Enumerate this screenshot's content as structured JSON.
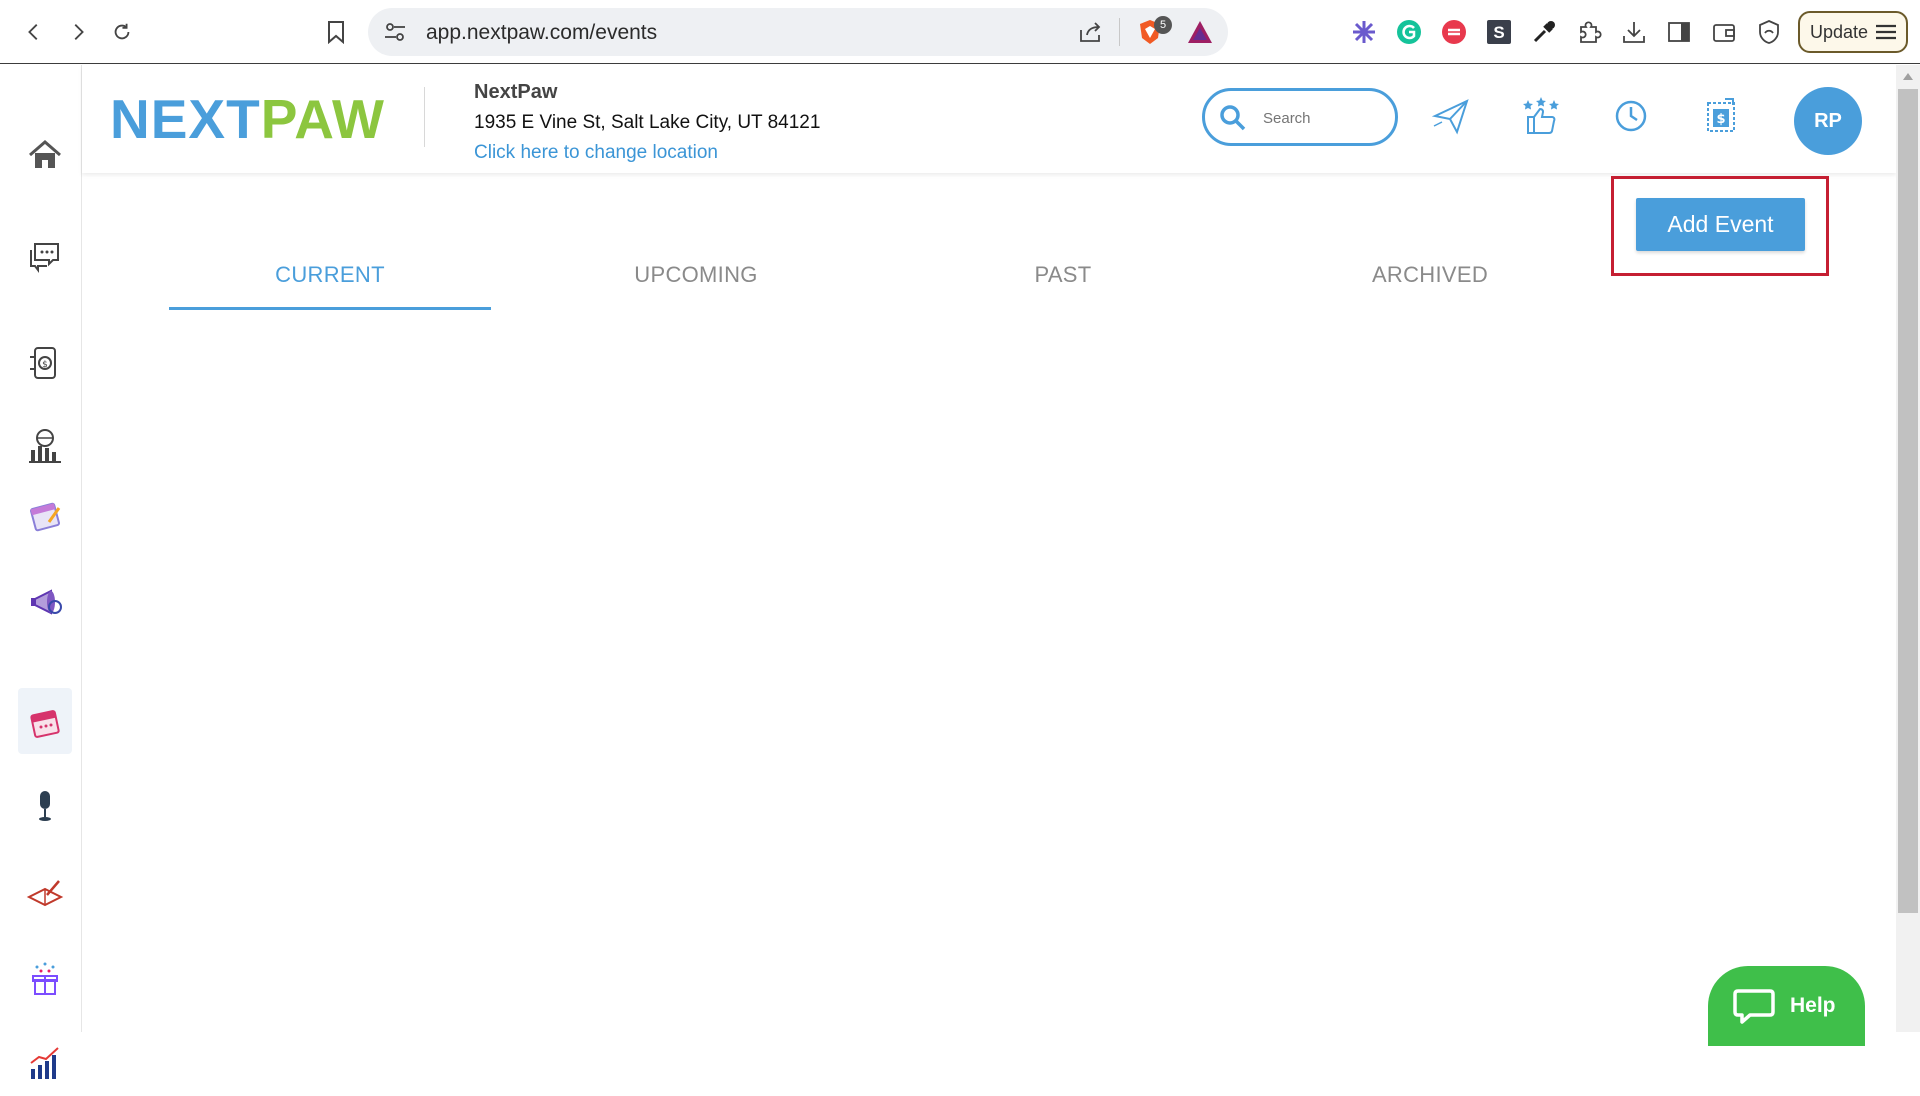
{
  "browser": {
    "url": "app.nextpaw.com/events",
    "brave_badge_count": "5",
    "update_label": "Update"
  },
  "header": {
    "logo_next": "NEXT",
    "logo_paw": "PAW",
    "business_name": "NextPaw",
    "business_address": "1935 E Vine St, Salt Lake City, UT 84121",
    "change_location_label": "Click here to change location",
    "search_placeholder": "Search",
    "avatar_initials": "RP"
  },
  "sidebar": {
    "items": [
      {
        "name": "home",
        "icon": "home-icon"
      },
      {
        "name": "messages",
        "icon": "chat-bubbles-icon"
      },
      {
        "name": "payments",
        "icon": "mobile-payment-icon"
      },
      {
        "name": "analytics",
        "icon": "globe-bar-chart-icon"
      },
      {
        "name": "calendar",
        "icon": "calendar-pencil-icon"
      },
      {
        "name": "marketing",
        "icon": "megaphone-icon"
      },
      {
        "name": "events",
        "icon": "events-calendar-icon",
        "active": true
      },
      {
        "name": "microphone",
        "icon": "microphone-icon"
      },
      {
        "name": "notes",
        "icon": "open-book-pencil-icon"
      },
      {
        "name": "rewards",
        "icon": "gift-box-icon"
      },
      {
        "name": "reports",
        "icon": "growth-chart-icon"
      }
    ]
  },
  "main": {
    "add_event_label": "Add Event",
    "tabs": [
      {
        "label": "CURRENT",
        "active": true
      },
      {
        "label": "UPCOMING",
        "active": false
      },
      {
        "label": "PAST",
        "active": false
      },
      {
        "label": "ARCHIVED",
        "active": false
      }
    ]
  },
  "help": {
    "label": "Help"
  },
  "colors": {
    "brand_blue": "#4a9edb",
    "brand_green": "#8cc63f",
    "highlight_red": "#c51f32",
    "help_green": "#3fbf4a"
  }
}
